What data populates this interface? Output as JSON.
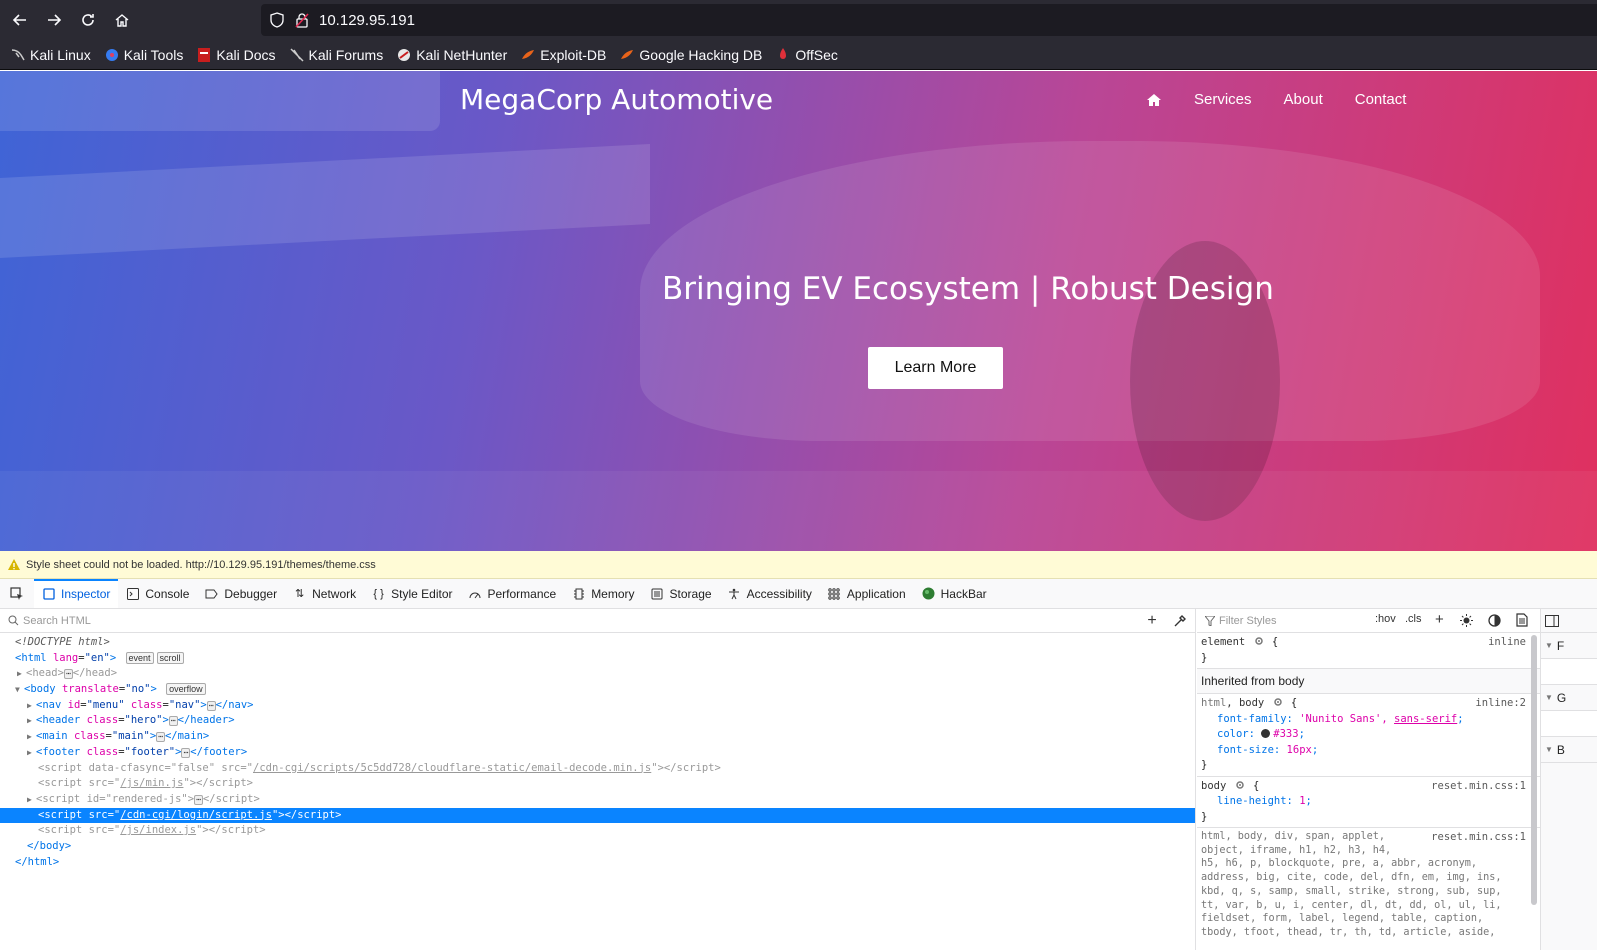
{
  "browser": {
    "url": "10.129.95.191",
    "bookmarks": [
      {
        "label": "Kali Linux",
        "icon": "kali-dragon-icon"
      },
      {
        "label": "Kali Tools",
        "icon": "kali-tools-icon"
      },
      {
        "label": "Kali Docs",
        "icon": "kali-docs-icon"
      },
      {
        "label": "Kali Forums",
        "icon": "kali-forums-icon"
      },
      {
        "label": "Kali NetHunter",
        "icon": "nethunter-icon"
      },
      {
        "label": "Exploit-DB",
        "icon": "exploit-db-icon"
      },
      {
        "label": "Google Hacking DB",
        "icon": "ghdb-icon"
      },
      {
        "label": "OffSec",
        "icon": "offsec-icon"
      }
    ]
  },
  "site": {
    "brand": "MegaCorp Automotive",
    "menu": [
      "Services",
      "About",
      "Contact"
    ],
    "hero_title": "Bringing EV Ecosystem | Robust Design",
    "cta": "Learn More"
  },
  "devtools": {
    "notice": "Style sheet could not be loaded. http://10.129.95.191/themes/theme.css",
    "tabs": [
      "Inspector",
      "Console",
      "Debugger",
      "Network",
      "Style Editor",
      "Performance",
      "Memory",
      "Storage",
      "Accessibility",
      "Application",
      "HackBar"
    ],
    "search_placeholder": "Search HTML",
    "filter_placeholder": "Filter Styles",
    "hov": ":hov",
    "cls": ".cls",
    "markup": {
      "doctype": "<!DOCTYPE html>",
      "script_cf_src": "/cdn-cgi/scripts/5c5dd728/cloudflare-static/email-decode.min.js",
      "script_min_src": "/js/min.js",
      "script_login_src": "/cdn-cgi/login/script.js",
      "script_index_src": "/js/index.js"
    },
    "rules": {
      "element_selector": "element",
      "element_src": "inline",
      "inherited_label": "Inherited from body",
      "html_body_src": "inline:2",
      "font_family_value": "'Nunito Sans', ",
      "font_family_generic": "sans-serif",
      "color_value": "#333",
      "font_size_value": "16px",
      "body_src": "reset.min.css:1",
      "line_height_value": "1",
      "reset_src": "reset.min.css:1",
      "reset_selectors": "html, body, div, span, applet,\nobject, iframe, h1, h2, h3, h4,\nh5, h6, p, blockquote, pre, a, abbr, acronym,\naddress, big, cite, code, del, dfn, em, img, ins,\nkbd, q, s, samp, small, strike, strong, sub, sup,\ntt, var, b, u, i, center, dl, dt, dd, ol, ul, li,\nfieldset, form, label, legend, table, caption,\ntbody, tfoot, thead, tr, th, td, article, aside,"
    },
    "side_panel": [
      "F",
      "G",
      "B"
    ]
  },
  "colors": {
    "chrome": "#2b2a33",
    "hero_start": "#3f64d6",
    "hero_end": "#e0305f",
    "selected": "#0a84ff"
  }
}
